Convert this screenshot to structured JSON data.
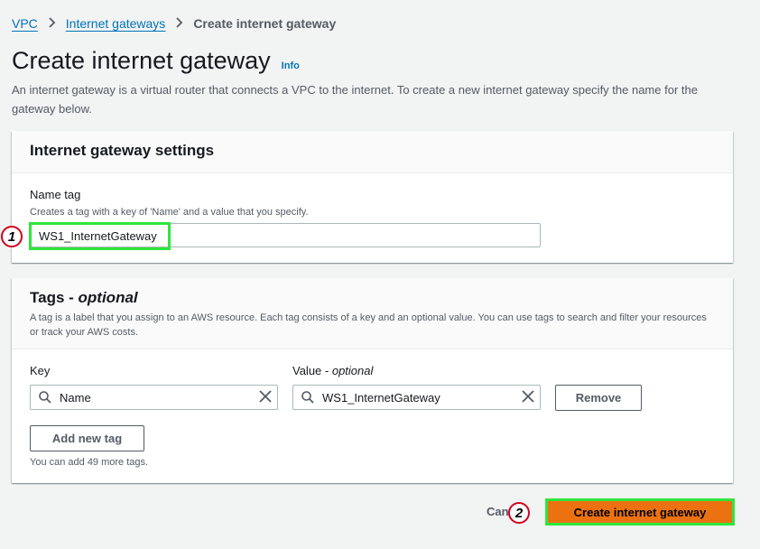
{
  "breadcrumb": {
    "items": [
      "VPC",
      "Internet gateways"
    ],
    "current": "Create internet gateway"
  },
  "header": {
    "title": "Create internet gateway",
    "info": "Info",
    "description": "An internet gateway is a virtual router that connects a VPC to the internet. To create a new internet gateway specify the name for the gateway below."
  },
  "settings": {
    "title": "Internet gateway settings",
    "name_label": "Name tag",
    "name_desc": "Creates a tag with a key of 'Name' and a value that you specify.",
    "name_value": "WS1_InternetGateway"
  },
  "tags": {
    "title": "Tags - ",
    "title_optional": "optional",
    "description": "A tag is a label that you assign to an AWS resource. Each tag consists of a key and an optional value. You can use tags to search and filter your resources or track your AWS costs.",
    "key_label": "Key",
    "value_label": "Value - ",
    "value_optional": "optional",
    "key_value": "Name",
    "value_value": "WS1_InternetGateway",
    "remove_label": "Remove",
    "add_label": "Add new tag",
    "remaining_text": "You can add 49 more tags."
  },
  "footer": {
    "cancel_label": "Cancel",
    "create_label": "Create internet gateway"
  },
  "annotations": {
    "step1": "1",
    "step2": "2"
  },
  "colors": {
    "link": "#0073bb",
    "primary_button": "#ec7211",
    "highlight": "#2ee63c",
    "annotation_ring": "#d0021b"
  }
}
